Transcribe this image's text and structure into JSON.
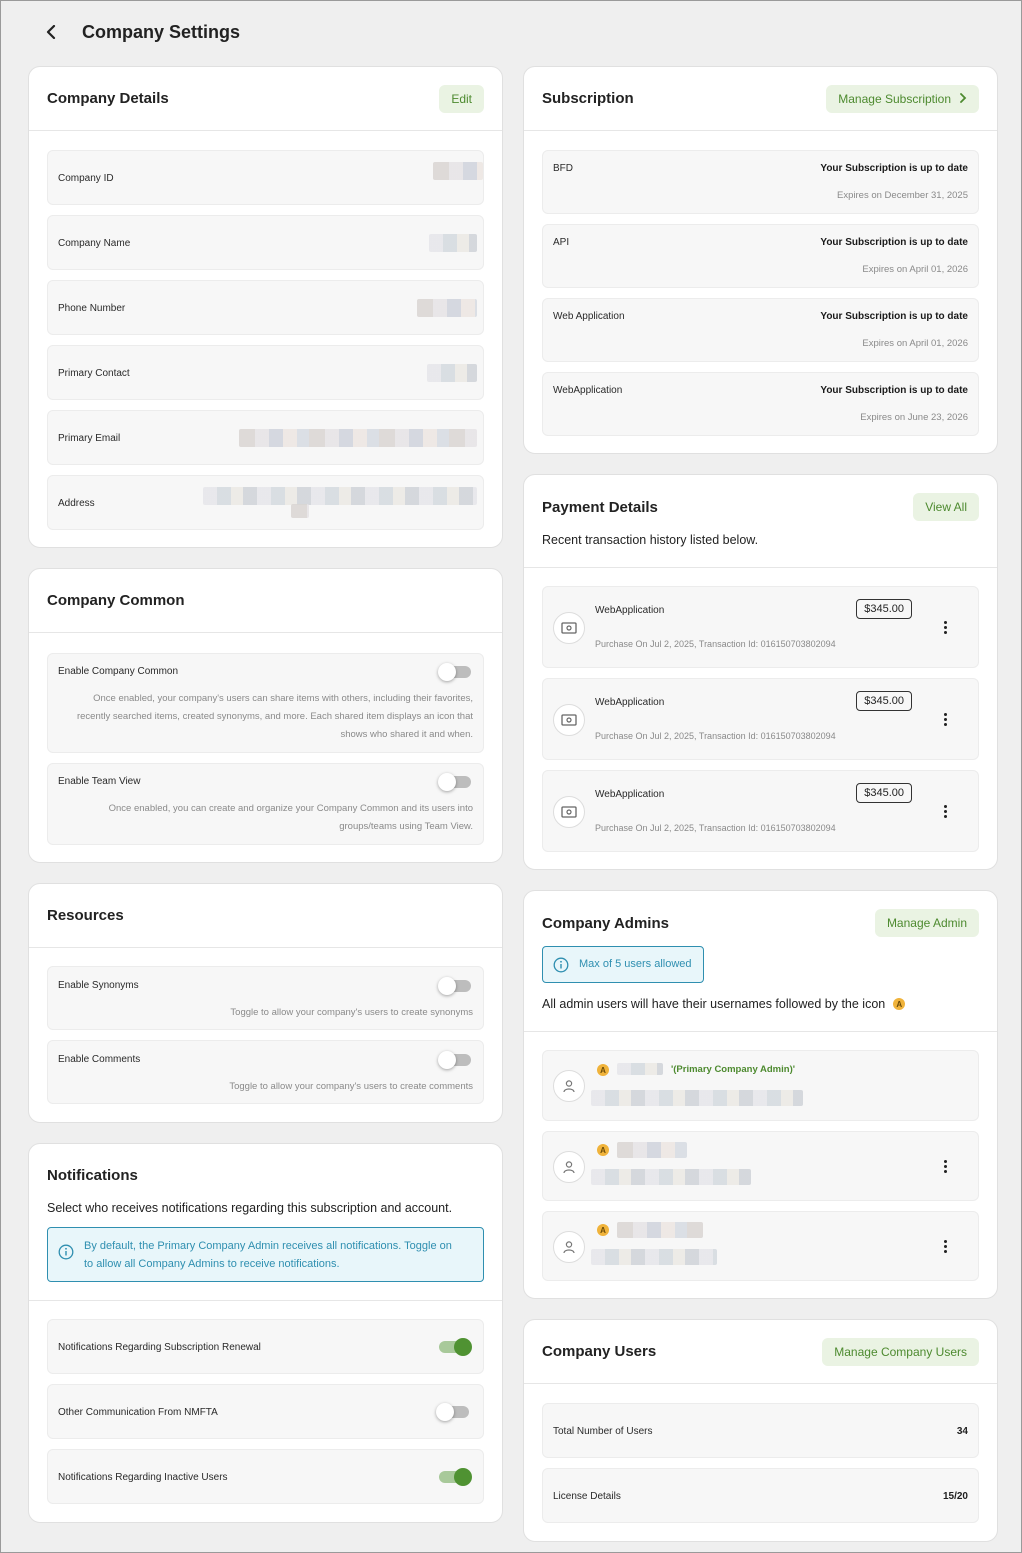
{
  "page": {
    "title": "Company Settings"
  },
  "company_details": {
    "title": "Company Details",
    "edit_label": "Edit",
    "fields": [
      {
        "label": "Company ID"
      },
      {
        "label": "Company Name"
      },
      {
        "label": "Phone Number"
      },
      {
        "label": "Primary Contact"
      },
      {
        "label": "Primary Email"
      },
      {
        "label": "Address"
      }
    ]
  },
  "company_common": {
    "title": "Company Common",
    "items": [
      {
        "label": "Enable Company Common",
        "enabled": false,
        "description": "Once enabled, your company's users can share items with others, including their favorites, recently searched items, created synonyms, and more. Each shared item displays an icon that shows who shared it and when."
      },
      {
        "label": "Enable Team View",
        "enabled": false,
        "description": "Once enabled, you can create and organize your Company Common and its users into groups/teams using Team View."
      }
    ]
  },
  "resources": {
    "title": "Resources",
    "items": [
      {
        "label": "Enable Synonyms",
        "enabled": false,
        "description": "Toggle to allow your company's users to create synonyms"
      },
      {
        "label": "Enable Comments",
        "enabled": false,
        "description": "Toggle to allow your company's users to create comments"
      }
    ]
  },
  "notifications": {
    "title": "Notifications",
    "subtitle": "Select who receives notifications regarding this subscription and account.",
    "info": "By default, the Primary Company Admin receives all notifications. Toggle on to allow all Company Admins to receive notifications.",
    "items": [
      {
        "label": "Notifications Regarding Subscription Renewal",
        "enabled": true
      },
      {
        "label": "Other Communication From NMFTA",
        "enabled": false
      },
      {
        "label": "Notifications Regarding Inactive Users",
        "enabled": true
      }
    ]
  },
  "subscription": {
    "title": "Subscription",
    "manage_label": "Manage Subscription",
    "items": [
      {
        "name": "BFD",
        "status": "Your Subscription is up to date",
        "expires": "Expires on December 31, 2025"
      },
      {
        "name": "API",
        "status": "Your Subscription is up to date",
        "expires": "Expires on April 01, 2026"
      },
      {
        "name": "Web Application",
        "status": "Your Subscription is up to date",
        "expires": "Expires on April 01, 2026"
      },
      {
        "name": "WebApplication",
        "status": "Your Subscription is up to date",
        "expires": "Expires on June 23, 2026"
      }
    ]
  },
  "payment": {
    "title": "Payment Details",
    "view_all_label": "View All",
    "subtitle": "Recent transaction history listed below.",
    "items": [
      {
        "name": "WebApplication",
        "amount": "$345.00",
        "detail": "Purchase On Jul 2, 2025, Transaction Id: 016150703802094"
      },
      {
        "name": "WebApplication",
        "amount": "$345.00",
        "detail": "Purchase On Jul 2, 2025, Transaction Id: 016150703802094"
      },
      {
        "name": "WebApplication",
        "amount": "$345.00",
        "detail": "Purchase On Jul 2, 2025, Transaction Id: 016150703802094"
      }
    ]
  },
  "admins": {
    "title": "Company Admins",
    "manage_label": "Manage Admin",
    "max_info": "Max of 5 users allowed",
    "icon_note": "All admin users will have their usernames followed by the icon",
    "badge_letter": "A",
    "primary_tag": "'(Primary Company Admin)'"
  },
  "users": {
    "title": "Company Users",
    "manage_label": "Manage Company Users",
    "total_label": "Total Number of Users",
    "total_value": "34",
    "license_label": "License Details",
    "license_value": "15/20"
  },
  "colors": {
    "accent": "#4f9232",
    "accent_bg": "#eaf3e3",
    "info": "#2f8fb0",
    "badge": "#f0b33b"
  }
}
